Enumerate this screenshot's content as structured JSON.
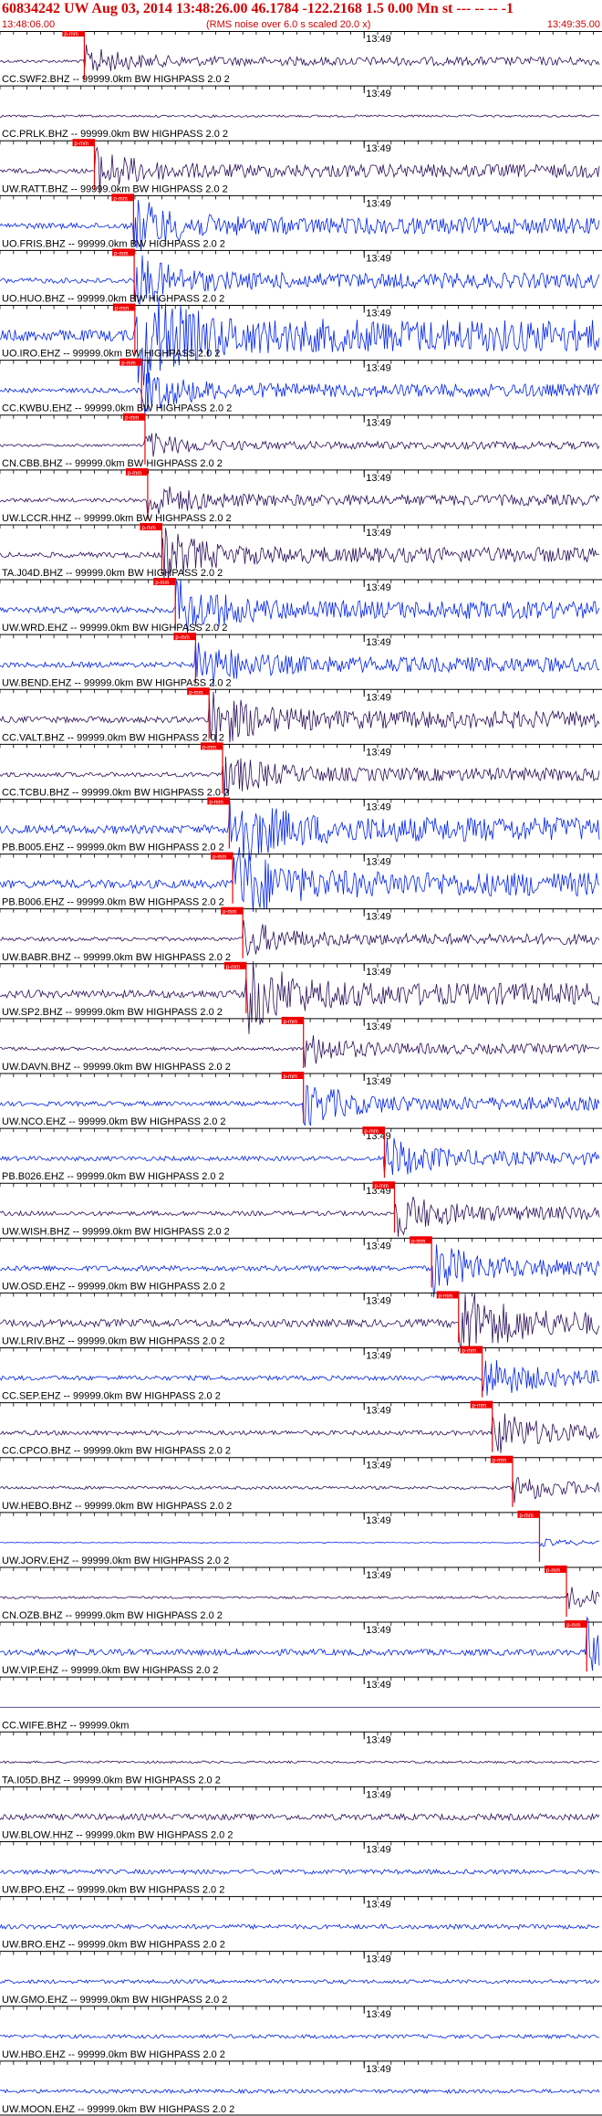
{
  "header": {
    "title": "60834242 UW Aug 03, 2014 13:48:26.00   46.1784 -122.2168  1.5 0.00 Mn st --- -- --  -1",
    "start_time": "13:48:06.00",
    "rms_note": "(RMS noise over 6.0 s scaled 20.0 x)",
    "end_time": "13:49:35.00"
  },
  "colors": {
    "trace_dark": "#2a0f5a",
    "trace_blue": "#0022ee",
    "pick": "#ee0000",
    "axis": "#000000"
  },
  "chart_data": {
    "type": "line",
    "title": "60834242 UW Aug 03, 2014 13:48:26.00   46.1784 -122.2168  1.5 0.00 Mn st --- -- --  -1",
    "x_start": "13:48:06.00",
    "x_end": "13:49:35.00",
    "time_mark": "13:49",
    "pick_label": "p-mm",
    "traces": [
      {
        "label": "CC.SWF2.BHZ -- 99999.0km BW  HIGHPASS  2.0  2",
        "pick": "13:48:18.5",
        "color": "dark",
        "amp": 0.08
      },
      {
        "label": "CC.PRLK.BHZ -- 99999.0km BW  HIGHPASS  2.0  2",
        "pick": "",
        "color": "dark",
        "amp": 0.06
      },
      {
        "label": "UW.RATT.BHZ -- 99999.0km BW  HIGHPASS  2.0  2",
        "pick": "13:48:20.0",
        "color": "dark",
        "amp": 0.12
      },
      {
        "label": "UO.FRIS.BHZ -- 99999.0km BW  HIGHPASS  2.0  2",
        "pick": "13:48:25.8",
        "color": "blue",
        "amp": 0.15
      },
      {
        "label": "UO.HUO.BHZ -- 99999.0km BW  HIGHPASS  2.0  2",
        "pick": "13:48:25.9",
        "color": "blue",
        "amp": 0.14
      },
      {
        "label": "UO.IRO.EHZ -- 99999.0km BW  HIGHPASS  2.0  2",
        "pick": "13:48:26.0",
        "color": "blue",
        "amp": 0.3
      },
      {
        "label": "CC.KWBU.EHZ -- 99999.0km BW  HIGHPASS  2.0  2",
        "pick": "13:48:27.0",
        "color": "blue",
        "amp": 0.12
      },
      {
        "label": "CN.CBB.BHZ -- 99999.0km BW  HIGHPASS  2.0  2",
        "pick": "13:48:27.5",
        "color": "dark",
        "amp": 0.07
      },
      {
        "label": "UW.LCCR.HHZ -- 99999.0km BW  HIGHPASS  2.0  2",
        "pick": "13:48:27.9",
        "color": "dark",
        "amp": 0.1
      },
      {
        "label": "TA.J04D.BHZ -- 99999.0km BW  HIGHPASS  2.0  2",
        "pick": "13:48:30.0",
        "color": "dark",
        "amp": 0.14
      },
      {
        "label": "UW.WRD.EHZ -- 99999.0km BW  HIGHPASS  2.0  2",
        "pick": "13:48:32.0",
        "color": "blue",
        "amp": 0.16
      },
      {
        "label": "UW.BEND.EHZ -- 99999.0km BW  HIGHPASS  2.0  2",
        "pick": "13:48:35.0",
        "color": "blue",
        "amp": 0.14
      },
      {
        "label": "CC.VALT.BHZ -- 99999.0km BW  HIGHPASS  2.0  2",
        "pick": "13:48:37.0",
        "color": "dark",
        "amp": 0.16
      },
      {
        "label": "CC.TCBU.BHZ -- 99999.0km BW  HIGHPASS  2.0  2",
        "pick": "13:48:39.0",
        "color": "dark",
        "amp": 0.12
      },
      {
        "label": "PB.B005.EHZ -- 99999.0km BW  HIGHPASS  2.0  2",
        "pick": "13:48:40.0",
        "color": "blue",
        "amp": 0.22
      },
      {
        "label": "PB.B006.EHZ -- 99999.0km BW  HIGHPASS  2.0  2",
        "pick": "13:48:40.5",
        "color": "blue",
        "amp": 0.22
      },
      {
        "label": "UW.BABR.BHZ -- 99999.0km BW  HIGHPASS  2.0  2",
        "pick": "13:48:42.0",
        "color": "dark",
        "amp": 0.1
      },
      {
        "label": "UW.SP2.BHZ -- 99999.0km BW  HIGHPASS  2.0  2",
        "pick": "13:48:42.5",
        "color": "dark",
        "amp": 0.2
      },
      {
        "label": "UW.DAVN.BHZ -- 99999.0km BW  HIGHPASS  2.0  2",
        "pick": "13:48:51.0",
        "color": "dark",
        "amp": 0.09
      },
      {
        "label": "UW.NCO.EHZ -- 99999.0km BW  HIGHPASS  2.0  2",
        "pick": "13:48:51.0",
        "color": "blue",
        "amp": 0.12
      },
      {
        "label": "PB.B026.EHZ -- 99999.0km BW  HIGHPASS  2.0  2",
        "pick": "13:49:03.0",
        "color": "blue",
        "amp": 0.12
      },
      {
        "label": "UW.WISH.BHZ -- 99999.0km BW  HIGHPASS  2.0  2",
        "pick": "13:49:04.5",
        "color": "dark",
        "amp": 0.12
      },
      {
        "label": "UW.OSD.EHZ -- 99999.0km BW  HIGHPASS  2.0  2",
        "pick": "13:49:10.0",
        "color": "blue",
        "amp": 0.14
      },
      {
        "label": "UW.LRIV.BHZ -- 99999.0km BW  HIGHPASS  2.0  2",
        "pick": "13:49:14.0",
        "color": "dark",
        "amp": 0.2
      },
      {
        "label": "CC.SEP.EHZ -- 99999.0km BW  HIGHPASS  2.0  2",
        "pick": "13:49:17.5",
        "color": "blue",
        "amp": 0.12
      },
      {
        "label": "CC.CPCO.BHZ -- 99999.0km BW  HIGHPASS  2.0  2",
        "pick": "13:49:19.0",
        "color": "dark",
        "amp": 0.12
      },
      {
        "label": "UW.HEBO.BHZ -- 99999.0km BW  HIGHPASS  2.0  2",
        "pick": "13:49:22.0",
        "color": "dark",
        "amp": 0.08
      },
      {
        "label": "UW.JORV.EHZ -- 99999.0km BW  HIGHPASS  2.0  2",
        "pick": "13:49:26.0",
        "color": "blue",
        "amp": 0.02
      },
      {
        "label": "CN.OZB.BHZ -- 99999.0km BW  HIGHPASS  2.0  2",
        "pick": "13:49:30.0",
        "color": "dark",
        "amp": 0.06
      },
      {
        "label": "UW.VIP.EHZ -- 99999.0km BW  HIGHPASS  2.0  2",
        "pick": "13:49:33.0",
        "color": "blue",
        "amp": 0.16
      },
      {
        "label": "CC.WIFE.BHZ -- 99999.0km",
        "pick": "",
        "color": "dark",
        "amp": 0.0
      },
      {
        "label": "TA.I05D.BHZ -- 99999.0km BW  HIGHPASS  2.0  2",
        "pick": "",
        "color": "dark",
        "amp": 0.06
      },
      {
        "label": "UW.BLOW.HHZ -- 99999.0km BW  HIGHPASS  2.0  2",
        "pick": "",
        "color": "dark",
        "amp": 0.16
      },
      {
        "label": "UW.BPO.EHZ -- 99999.0km BW  HIGHPASS  2.0  2",
        "pick": "",
        "color": "blue",
        "amp": 0.12
      },
      {
        "label": "UW.BRO.EHZ -- 99999.0km BW  HIGHPASS  2.0  2",
        "pick": "",
        "color": "blue",
        "amp": 0.12
      },
      {
        "label": "UW.GMO.EHZ -- 99999.0km BW  HIGHPASS  2.0  2",
        "pick": "",
        "color": "blue",
        "amp": 0.1
      },
      {
        "label": "UW.HBO.EHZ -- 99999.0km BW  HIGHPASS  2.0  2",
        "pick": "",
        "color": "blue",
        "amp": 0.1
      },
      {
        "label": "UW.MOON.EHZ -- 99999.0km BW  HIGHPASS  2.0  2",
        "pick": "",
        "color": "blue",
        "amp": 0.1
      }
    ],
    "grid": false,
    "legend": "none"
  }
}
